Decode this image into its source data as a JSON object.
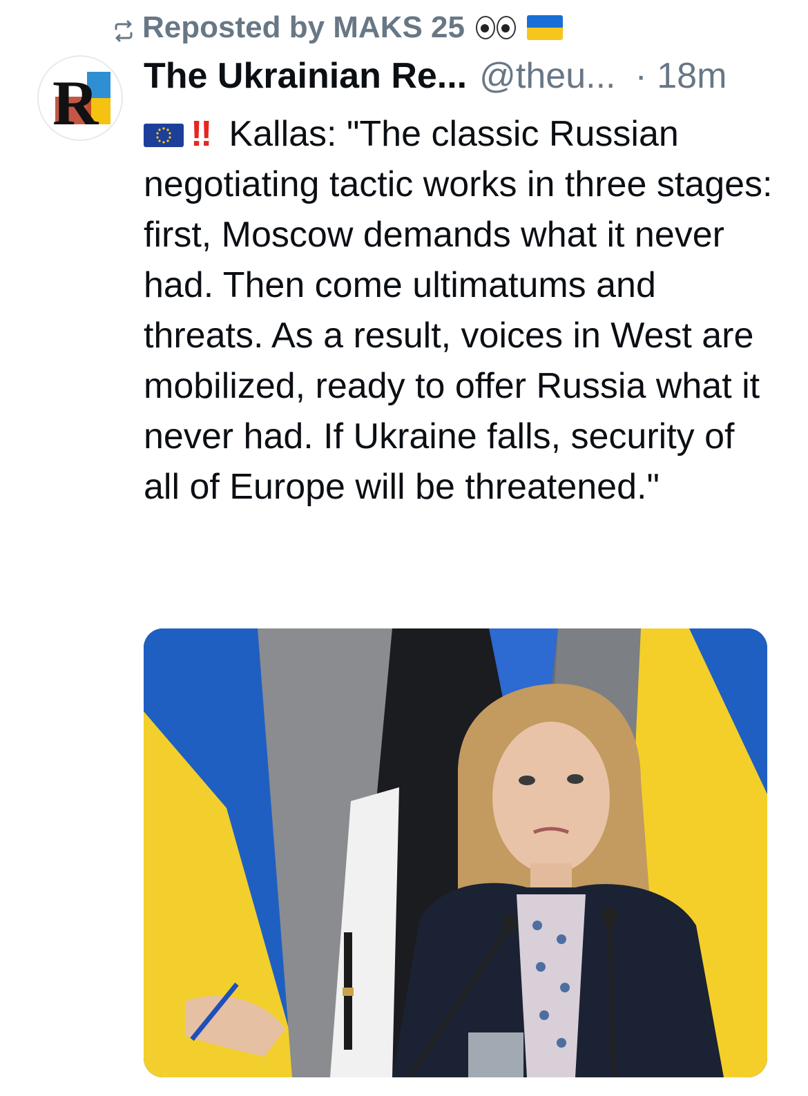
{
  "repost": {
    "text": "Reposted by MAKS 25",
    "icons": [
      "repost-icon",
      "eyes-emoji",
      "ukraine-flag-emoji"
    ]
  },
  "post": {
    "author_name": "The Ukrainian Re...",
    "author_handle": "@theu...",
    "time": "· 18m",
    "avatar_letter": "R",
    "lead_icons": [
      "eu-flag-emoji",
      "double-exclamation-emoji"
    ],
    "lead_bang": "‼",
    "body": "Kallas: \"The classic Russian negotiating tactic works in three stages: first, Moscow demands what it never had. Then come ultimatums and threats. As a result, voices in West are mobilized, ready to offer Russia what it never had. If Ukraine falls, security of all of Europe will be threatened.\""
  },
  "colors": {
    "muted": "#687785",
    "text": "#0b0f14",
    "ukraine_blue": "#1a6fd6",
    "ukraine_yellow": "#f7c61e",
    "eu_blue": "#1d3f9a",
    "bang_red": "#e8251f"
  }
}
